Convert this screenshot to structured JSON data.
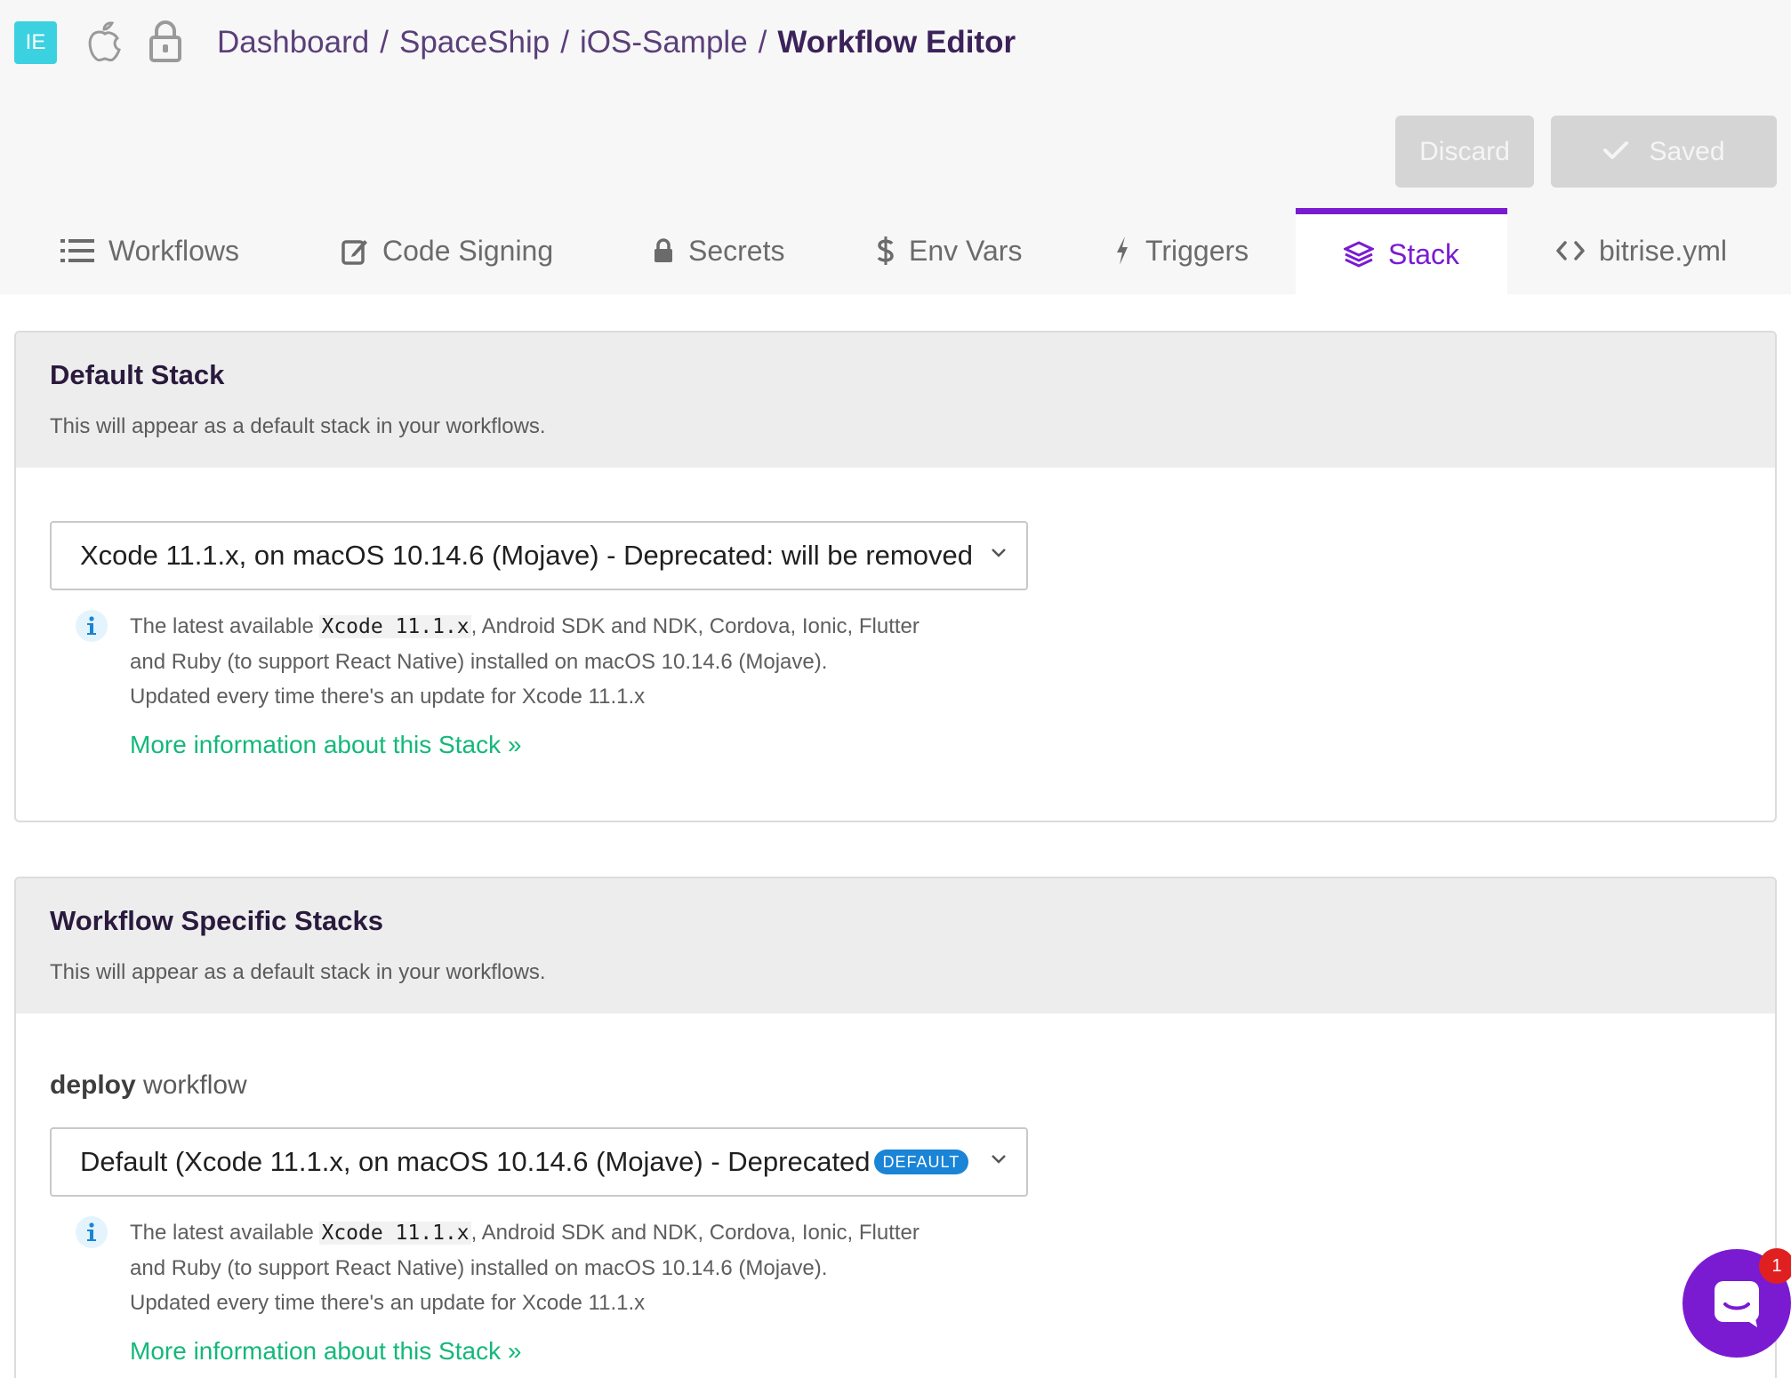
{
  "app": {
    "badge": "IE"
  },
  "breadcrumb": {
    "items": [
      "Dashboard",
      "SpaceShip",
      "iOS-Sample"
    ],
    "separator": "/",
    "current": "Workflow Editor"
  },
  "actions": {
    "discard_label": "Discard",
    "saved_label": "Saved"
  },
  "tabs": [
    {
      "label": "Workflows",
      "icon": "list-icon"
    },
    {
      "label": "Code Signing",
      "icon": "edit-icon"
    },
    {
      "label": "Secrets",
      "icon": "lock-icon"
    },
    {
      "label": "Env Vars",
      "icon": "dollar-icon"
    },
    {
      "label": "Triggers",
      "icon": "bolt-icon"
    },
    {
      "label": "Stack",
      "icon": "layers-icon",
      "active": true
    },
    {
      "label": "bitrise.yml",
      "icon": "code-icon"
    }
  ],
  "default_stack": {
    "title": "Default Stack",
    "subtitle": "This will appear as a default stack in your workflows.",
    "selected": "Xcode 11.1.x, on macOS 10.14.6 (Mojave) - Deprecated: will be removed",
    "info_prefix": "The latest available",
    "info_code": "Xcode 11.1.x",
    "info_line1_rest": ", Android SDK and NDK, Cordova, Ionic, Flutter",
    "info_line2": "and Ruby (to support React Native) installed on macOS 10.14.6 (Mojave).",
    "info_line3": "Updated every time there's an update for Xcode 11.1.x",
    "more_link": "More information about this Stack »"
  },
  "workflow_stacks": {
    "title": "Workflow Specific Stacks",
    "subtitle": "This will appear as a default stack in your workflows.",
    "workflows": [
      {
        "name": "deploy",
        "suffix": "workflow",
        "selected": "Default (Xcode 11.1.x, on macOS 10.14.6 (Mojave) - Deprecated",
        "badge": "DEFAULT",
        "info_prefix": "The latest available",
        "info_code": "Xcode 11.1.x",
        "info_line1_rest": ", Android SDK and NDK, Cordova, Ionic, Flutter",
        "info_line2": "and Ruby (to support React Native) installed on macOS 10.14.6 (Mojave).",
        "info_line3": "Updated every time there's an update for Xcode 11.1.x",
        "more_link": "More information about this Stack »"
      }
    ]
  },
  "chat": {
    "unread_count": "1",
    "icon": "chat-icon"
  },
  "colors": {
    "accent": "#7a1bd2",
    "link": "#14b87a",
    "badge_blue": "#1a84d6",
    "app_badge": "#3bd1e0"
  }
}
